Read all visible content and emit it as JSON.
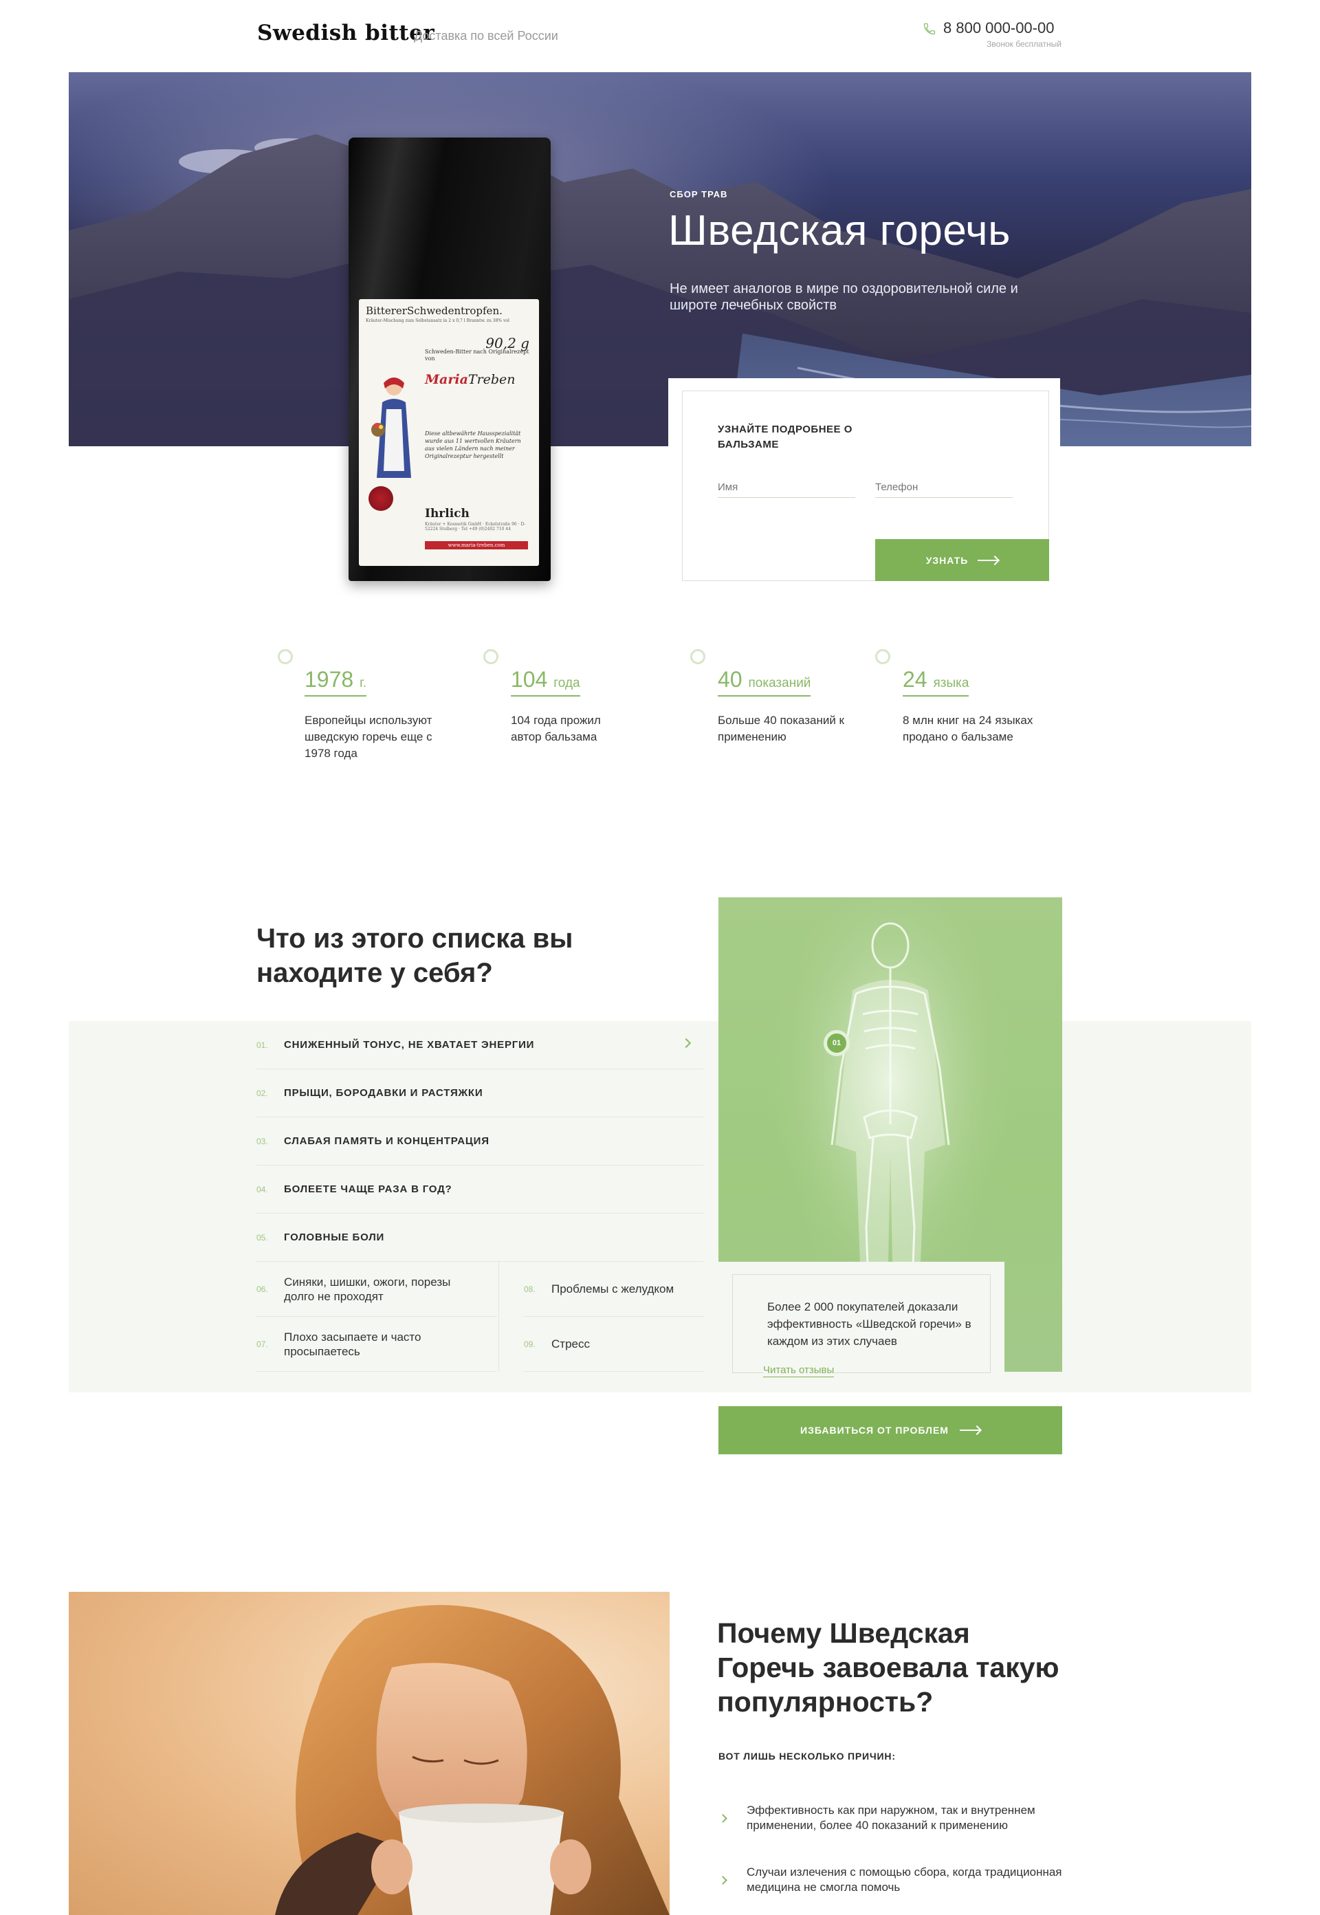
{
  "header": {
    "logo": "Swedish bitter",
    "delivery": "Доставка по всей России",
    "phone": "8 800 000-00-00",
    "phone_note": "Звонок бесплатный"
  },
  "hero": {
    "kicker": "СБОР ТРАВ",
    "title": "Шведская горечь",
    "subtitle": "Не имеет аналогов в мире по оздоровительной силе и широте лечебных свойств"
  },
  "product_label": {
    "name_a": "Bitterer",
    "name_b": "Schwedentropfen.",
    "composition": "Kräuter-Mischung zum Selbstansatz in 2 x 0,7 l Branntw. zu 38% vol",
    "weight": "90,2 g",
    "line1": "Schweden-Bitter nach Originalrezept von",
    "brand_a": "Maria",
    "brand_b": "Treben",
    "desc": "Diese altbewährte Hausspezialität wurde aus 11 wertvollen Kräutern aus vielen Ländern nach meiner Originalrezeptur hergestellt",
    "maker": "Ihrlich",
    "address": "Kräuter + Kosmetik GmbH · Eckelstraße 96 · D-52224 Stolberg · Tel +49 (0)2402 710 44",
    "url": "www.maria-treben.com"
  },
  "form": {
    "title": "УЗНАЙТЕ ПОДРОБНЕЕ О БАЛЬЗАМЕ",
    "name_placeholder": "Имя",
    "phone_placeholder": "Телефон",
    "submit": "УЗНАТЬ"
  },
  "stats": [
    {
      "value": "1978",
      "unit": "г.",
      "text": "Европейцы используют шведскую горечь еще с 1978 года"
    },
    {
      "value": "104",
      "unit": "года",
      "text": "104 года прожил автор бальзама"
    },
    {
      "value": "40",
      "unit": "показаний",
      "text": "Больше 40 показаний к применению"
    },
    {
      "value": "24",
      "unit": "языка",
      "text": "8 млн книг на 24 языках продано о бальзаме"
    }
  ],
  "problems": {
    "title": "Что из этого списка вы находите у себя?",
    "items": [
      {
        "num": "01.",
        "text": "СНИЖЕННЫЙ ТОНУС, НЕ ХВАТАЕТ ЭНЕРГИИ"
      },
      {
        "num": "02.",
        "text": "ПРЫЩИ, БОРОДАВКИ И РАСТЯЖКИ"
      },
      {
        "num": "03.",
        "text": "СЛАБАЯ ПАМЯТЬ И КОНЦЕНТРАЦИЯ"
      },
      {
        "num": "04.",
        "text": "БОЛЕЕТЕ ЧАЩЕ РАЗА В ГОД?"
      },
      {
        "num": "05.",
        "text": "ГОЛОВНЫЕ БОЛИ"
      },
      {
        "num": "06.",
        "text": "Синяки, шишки, ожоги, порезы долго не проходят"
      },
      {
        "num": "07.",
        "text": "Плохо засыпаете и часто просыпаетесь"
      },
      {
        "num": "08.",
        "text": "Проблемы с желудком"
      },
      {
        "num": "09.",
        "text": "Стресс"
      }
    ],
    "marker": "01",
    "info": "Более 2 000 покупателей доказали эффективность «Шведской горечи» в каждом из этих случаев",
    "reviews_link": "Читать отзывы",
    "cta": "ИЗБАВИТЬСЯ ОТ ПРОБЛЕМ"
  },
  "why": {
    "title": "Почему Шведская Горечь завоевала такую популярность?",
    "subtitle": "ВОТ ЛИШЬ НЕСКОЛЬКО ПРИЧИН:",
    "reasons": [
      "Эффективность как при наружном, так и внутреннем применении, более 40 показаний к применению",
      "Случаи излечения с помощью сбора, когда традиционная медицина не смогла помочь"
    ]
  },
  "colors": {
    "accent": "#7fb256",
    "accent_light": "#a6cc88",
    "logo_red": "#c0262d",
    "hero_dark": "#2f2f4f",
    "band_bg": "#f5f7f2"
  },
  "icons": [
    "phone-icon",
    "arrow-right-icon",
    "chevron-right-icon"
  ]
}
